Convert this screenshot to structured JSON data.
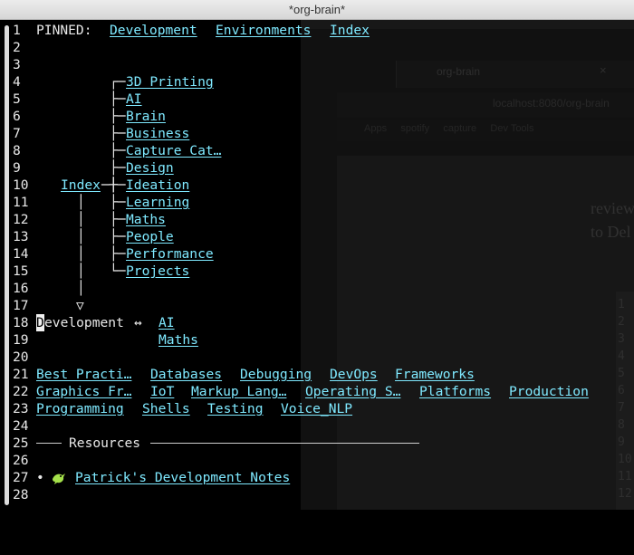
{
  "window": {
    "title": "*org-brain*"
  },
  "background_window": {
    "tab_title": "org-brain",
    "url": "localhost:8080/org-brain",
    "bookmarks": "Apps     spotify     capture     Dev Tools",
    "page_text": "review\nto Del",
    "line_numbers": "1\n2\n3\n4\n5\n6\n7\n8\n9\n10\n11\n12"
  },
  "editor": {
    "line_numbers": [
      "1",
      "2",
      "3",
      "4",
      "5",
      "6",
      "7",
      "8",
      "9",
      "10",
      "11",
      "12",
      "13",
      "14",
      "15",
      "16",
      "17",
      "18",
      "19",
      "20",
      "21",
      "22",
      "23",
      "24",
      "25",
      "26",
      "27",
      "28"
    ],
    "pinned": {
      "label": "PINNED:",
      "links": [
        "Development",
        "Environments",
        "Index"
      ]
    },
    "children": [
      "3D Printing",
      "AI",
      "Brain",
      "Business",
      "Capture Cat…",
      "Design",
      "Ideation",
      "Learning",
      "Maths",
      "People",
      "Performance",
      "Projects"
    ],
    "parent": "Index",
    "arrow_down": "▽",
    "current": {
      "first_char": "D",
      "rest": "evelopment",
      "relation_arrow": "↔",
      "friends": [
        "AI",
        "Maths"
      ]
    },
    "siblings_rows": [
      [
        "Best Practi…",
        "Databases",
        "Debugging",
        "DevOps",
        "Frameworks"
      ],
      [
        "Graphics Fr…",
        "IoT",
        "Markup Lang…",
        "Operating S…",
        "Platforms",
        "Production"
      ],
      [
        "Programming",
        "Shells",
        "Testing",
        "Voice_NLP"
      ]
    ],
    "resources": {
      "heading": "Resources",
      "bullet": "•",
      "items": [
        {
          "icon": "green-bird-icon",
          "label": "Patrick's Development Notes"
        }
      ]
    }
  },
  "colors": {
    "link": "#7fe9ff",
    "text": "#e8e8e8",
    "background": "#000000"
  }
}
